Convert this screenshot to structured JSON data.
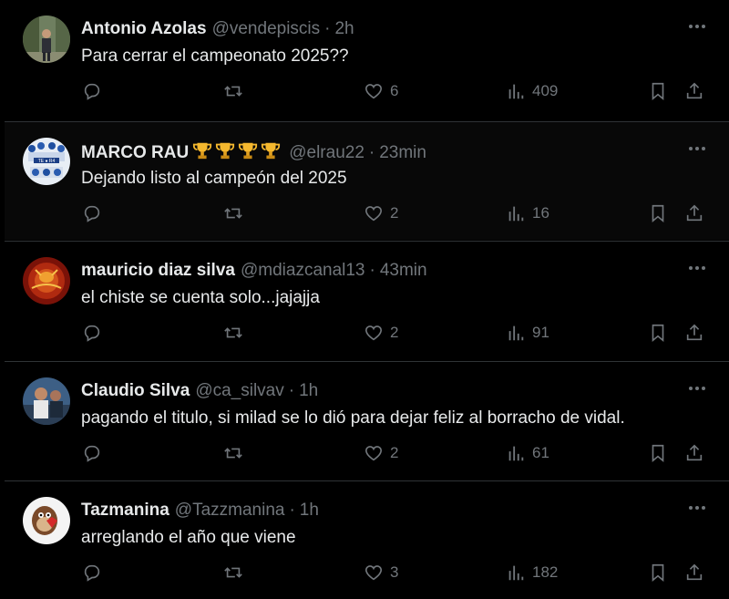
{
  "tweets": [
    {
      "name": "Antonio Azolas",
      "handle": "@vendepiscis",
      "dot": "·",
      "time": "2h",
      "text": "Para cerrar el campeonato 2025??",
      "likes": "6",
      "views": "409"
    },
    {
      "name": "MARCO RAU",
      "handle": "@elrau22",
      "dot": "·",
      "time": "23min",
      "text": "Dejando listo al campeón del 2025",
      "likes": "2",
      "views": "16"
    },
    {
      "name": "mauricio diaz silva",
      "handle": "@mdiazcanal13",
      "dot": "·",
      "time": "43min",
      "text": "el chiste se cuenta solo...jajajja",
      "likes": "2",
      "views": "91"
    },
    {
      "name": "Claudio Silva",
      "handle": "@ca_silvav",
      "dot": "·",
      "time": "1h",
      "text": "pagando el titulo, si milad se lo dió para dejar feliz al borracho de vidal.",
      "likes": "2",
      "views": "61"
    },
    {
      "name": "Tazmanina",
      "handle": "@Tazzmanina",
      "dot": "·",
      "time": "1h",
      "text": "arreglando el año que viene",
      "likes": "3",
      "views": "182"
    }
  ],
  "icons": {
    "reply": "reply-icon",
    "retweet": "retweet-icon",
    "like": "heart-icon",
    "views": "views-icon",
    "bookmark": "bookmark-icon",
    "share": "share-icon",
    "more": "more-icon",
    "trophy": "trophy-icon"
  },
  "colors": {
    "background": "#000000",
    "text": "#e7e9ea",
    "muted": "#71767b",
    "divider": "#2f3336"
  }
}
